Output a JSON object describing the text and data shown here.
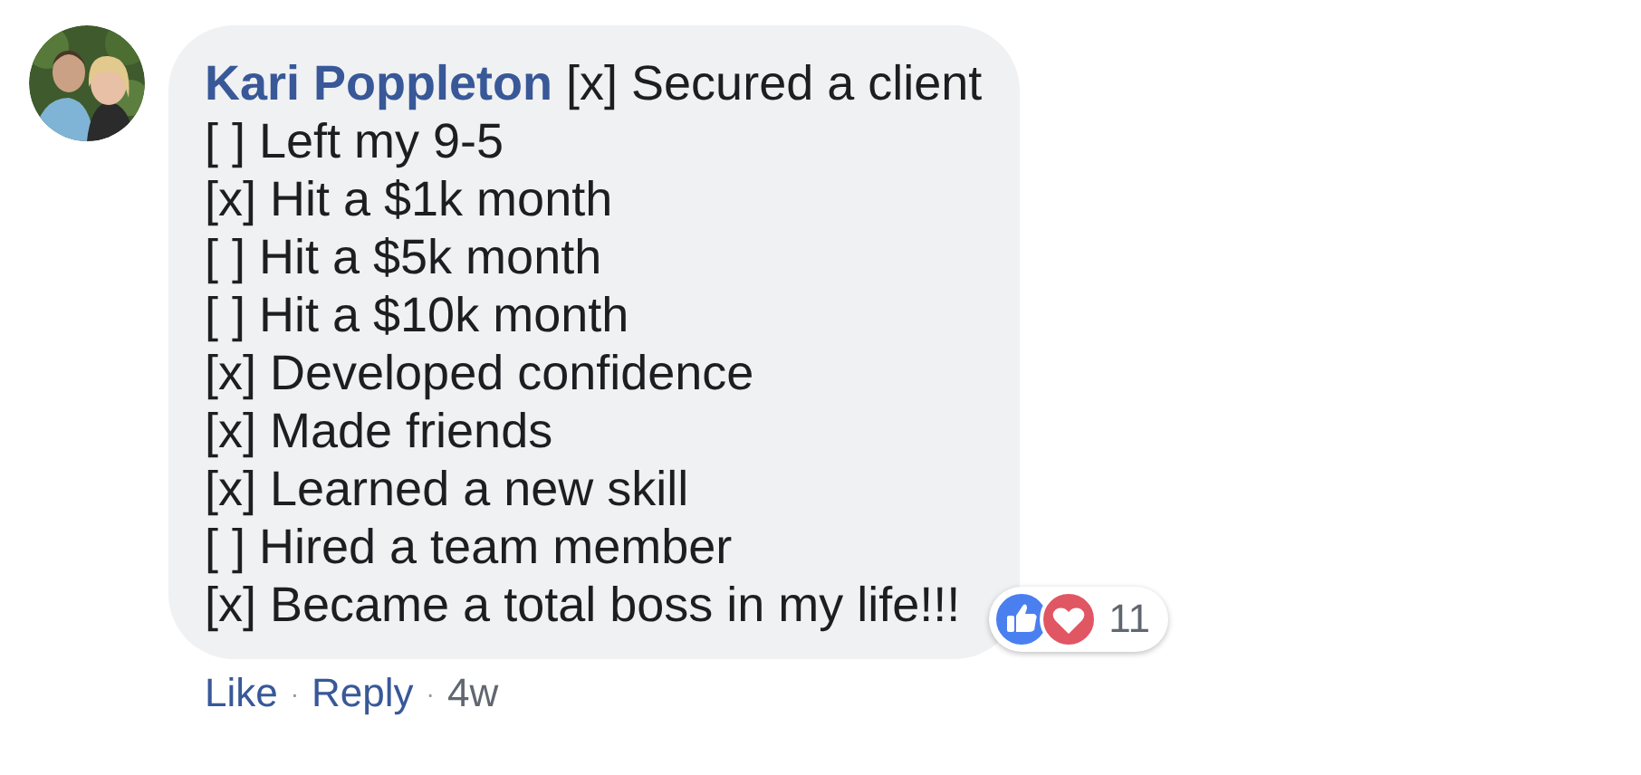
{
  "comment": {
    "author": "Kari Poppleton",
    "lines": [
      "[x] Secured a client",
      "[ ] Left my 9-5",
      "[x] Hit a $1k month",
      "[ ] Hit a $5k month",
      "[ ] Hit a $10k month",
      "[x] Developed confidence",
      "[x] Made friends",
      "[x] Learned a new skill",
      "[ ] Hired a team member",
      "[x] Became a total boss in my life!!!"
    ],
    "reactions": {
      "icons": [
        {
          "kind": "like"
        },
        {
          "kind": "love"
        }
      ],
      "count": "11"
    },
    "actions": [
      {
        "kind": "link",
        "text": "Like"
      },
      {
        "kind": "separator",
        "text": "·"
      },
      {
        "kind": "link",
        "text": "Reply"
      },
      {
        "kind": "separator",
        "text": "·"
      },
      {
        "kind": "time",
        "text": "4w"
      }
    ]
  }
}
